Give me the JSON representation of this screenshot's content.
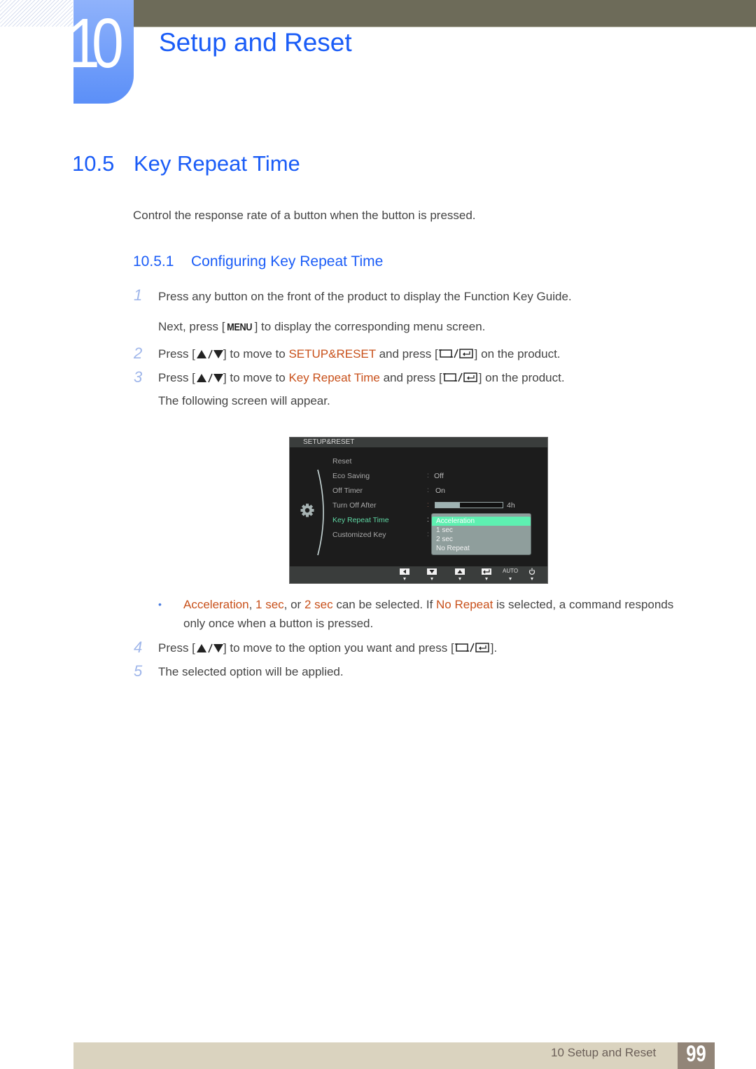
{
  "chapter": {
    "number": "10",
    "title": "Setup and Reset"
  },
  "section": {
    "number": "10.5",
    "title": "Key Repeat Time",
    "intro": "Control the response rate of a button when the button is pressed."
  },
  "subsection": {
    "number": "10.5.1",
    "title": "Configuring Key Repeat Time"
  },
  "steps": [
    {
      "num": "1",
      "text": "Press any button on the front of the product to display the Function Key Guide."
    },
    {
      "num": "",
      "pre": "Next, press [",
      "key": "MENU",
      "post": "] to display the corresponding menu screen."
    },
    {
      "num": "2",
      "pre": "Press [",
      "mid": "] to move to ",
      "highlight": "SETUP&RESET",
      "mid2": " and press [",
      "post": "] on the product."
    },
    {
      "num": "3",
      "pre": "Press [",
      "mid": "] to move to ",
      "highlight": "Key Repeat Time",
      "mid2": " and press [",
      "post": "] on the product."
    },
    {
      "num": "",
      "text": "The following screen will appear."
    },
    {
      "num": "4",
      "pre": "Press [",
      "mid": "] to move to the option you want and press [",
      "post": "]."
    },
    {
      "num": "5",
      "text": "The selected option will be applied."
    }
  ],
  "note": {
    "opt1": "Acceleration",
    "sep1": ", ",
    "opt2": "1 sec",
    "sep2": ", or ",
    "opt3": "2 sec",
    "mid": " can be selected. If ",
    "opt4": "No Repeat",
    "end": " is selected, a command responds",
    "line2": "only once when a button is pressed."
  },
  "osd": {
    "header": "SETUP&RESET",
    "menu": [
      {
        "label": "Reset",
        "value": ""
      },
      {
        "label": "Eco Saving",
        "value": "Off"
      },
      {
        "label": "Off Timer",
        "value": "On"
      },
      {
        "label": "Turn Off After",
        "value": "4h",
        "progress": 0.36
      },
      {
        "label": "Key Repeat Time",
        "selected": true
      },
      {
        "label": "Customized Key"
      }
    ],
    "dropdown": [
      "Acceleration",
      "1 sec",
      "2 sec",
      "No Repeat"
    ],
    "dropdown_selected": "Acceleration",
    "footer_buttons": [
      "left-icon",
      "down-icon",
      "up-icon",
      "enter-icon",
      "AUTO",
      "power-icon"
    ],
    "colors": {
      "selected_text": "#5fd6a3",
      "selected_option": "#5ef0b1"
    }
  },
  "footer": {
    "label": "10 Setup and Reset",
    "page": "99"
  },
  "colors": {
    "heading": "#1a5cf7",
    "highlight": "#c8501a",
    "step_number": "#9fb6ea",
    "top_bar": "#6d6b59",
    "footer_bar": "#dad3bf",
    "page_box": "#928578"
  }
}
